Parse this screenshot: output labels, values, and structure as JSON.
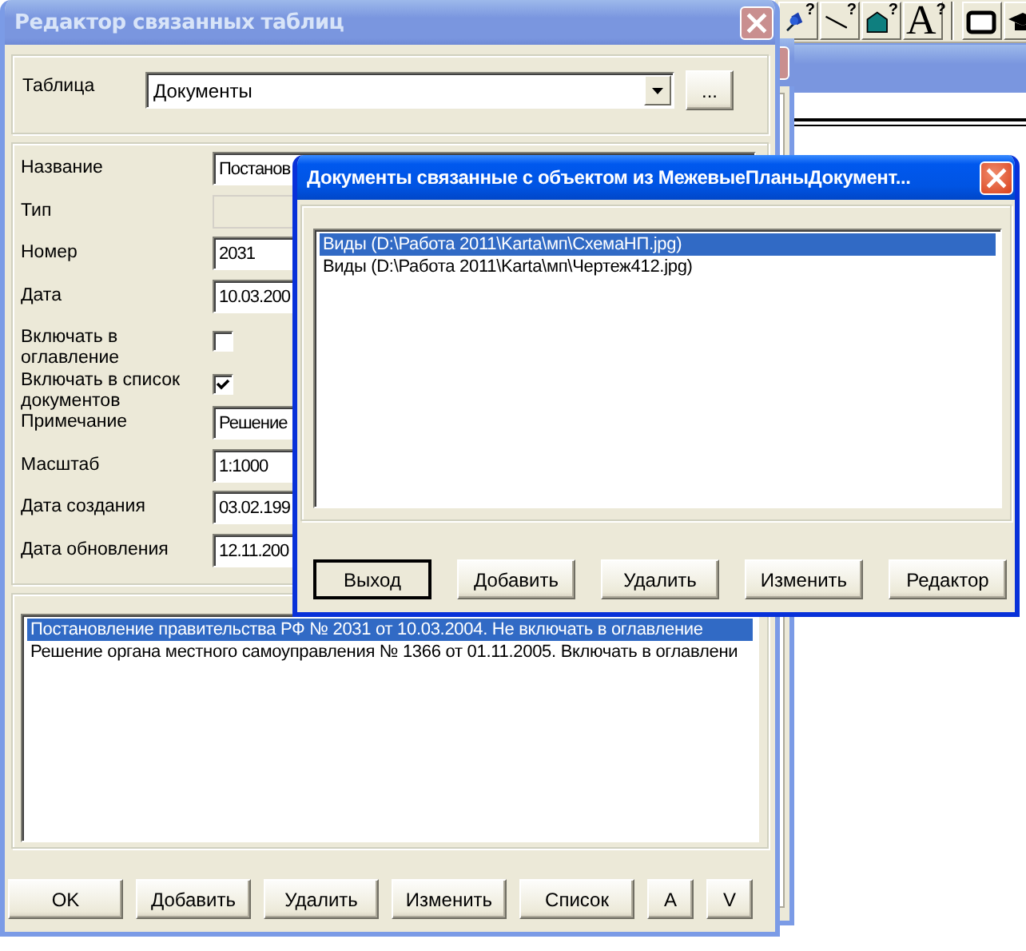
{
  "toolbar": [
    {
      "kind": "pin",
      "badge": "?"
    },
    {
      "kind": "line",
      "badge": "?"
    },
    {
      "kind": "house",
      "badge": "?"
    },
    {
      "kind": "letter",
      "label": "A",
      "badge": "?"
    },
    {
      "kind": "separator"
    },
    {
      "kind": "frame"
    },
    {
      "kind": "cap"
    }
  ],
  "main_dialog": {
    "title": "Редактор связанных таблиц",
    "active": false,
    "table_label": "Таблица",
    "table_value": "Документы",
    "browse_button": "...",
    "fields": [
      {
        "kind": "text",
        "label": "Название",
        "value": "Постанов",
        "disabled": false
      },
      {
        "kind": "text",
        "label": "Тип",
        "disabled": true
      },
      {
        "kind": "text",
        "label": "Номер",
        "value": "2031",
        "disabled": false
      },
      {
        "kind": "text",
        "label": "Дата",
        "value": "10.03.200",
        "disabled": false
      },
      {
        "kind": "checkbox",
        "label": "Включать в оглавление",
        "checked": false,
        "disabled": false
      },
      {
        "kind": "checkbox",
        "label": "Включать в список документов",
        "checked": true,
        "disabled": false
      },
      {
        "kind": "text",
        "label": "Примечание",
        "value": "Решение",
        "disabled": false
      },
      {
        "kind": "text",
        "label": "Масштаб",
        "value": "1:1000",
        "disabled": false
      },
      {
        "kind": "text",
        "label": "Дата создания",
        "value": "03.02.199",
        "disabled": false
      },
      {
        "kind": "text",
        "label": "Дата обновления",
        "value": "12.11.200",
        "disabled": false
      }
    ],
    "records": [
      {
        "text": "Постановление правительства РФ № 2031 от 10.03.2004. Не включать в оглавление",
        "selected": true
      },
      {
        "text": "Решение органа местного самоуправления № 1366 от 01.11.2005. Включать в оглавлени",
        "selected": false
      }
    ],
    "buttons": [
      {
        "label": "OK",
        "kind": "wide"
      },
      {
        "label": "Добавить",
        "kind": "wide"
      },
      {
        "label": "Удалить",
        "kind": "wide"
      },
      {
        "label": "Изменить",
        "kind": "wide"
      },
      {
        "label": "Список",
        "kind": "wide"
      },
      {
        "label": "A",
        "kind": "narrow"
      },
      {
        "label": "V",
        "kind": "narrow"
      }
    ]
  },
  "linked_dialog": {
    "title": "Документы связанные с объектом из МежевыеПланыДокумент...",
    "active": true,
    "files": [
      {
        "text": "Виды (D:\\Работа 2011\\Karta\\мп\\СхемаНП.jpg)",
        "selected": true
      },
      {
        "text": "Виды (D:\\Работа 2011\\Karta\\мп\\Чертеж412.jpg)",
        "selected": false
      }
    ],
    "buttons": [
      {
        "label": "Выход",
        "default": true
      },
      {
        "label": "Добавить",
        "default": false
      },
      {
        "label": "Удалить",
        "default": false
      },
      {
        "label": "Изменить",
        "default": false
      },
      {
        "label": "Редактор",
        "default": false
      }
    ]
  }
}
